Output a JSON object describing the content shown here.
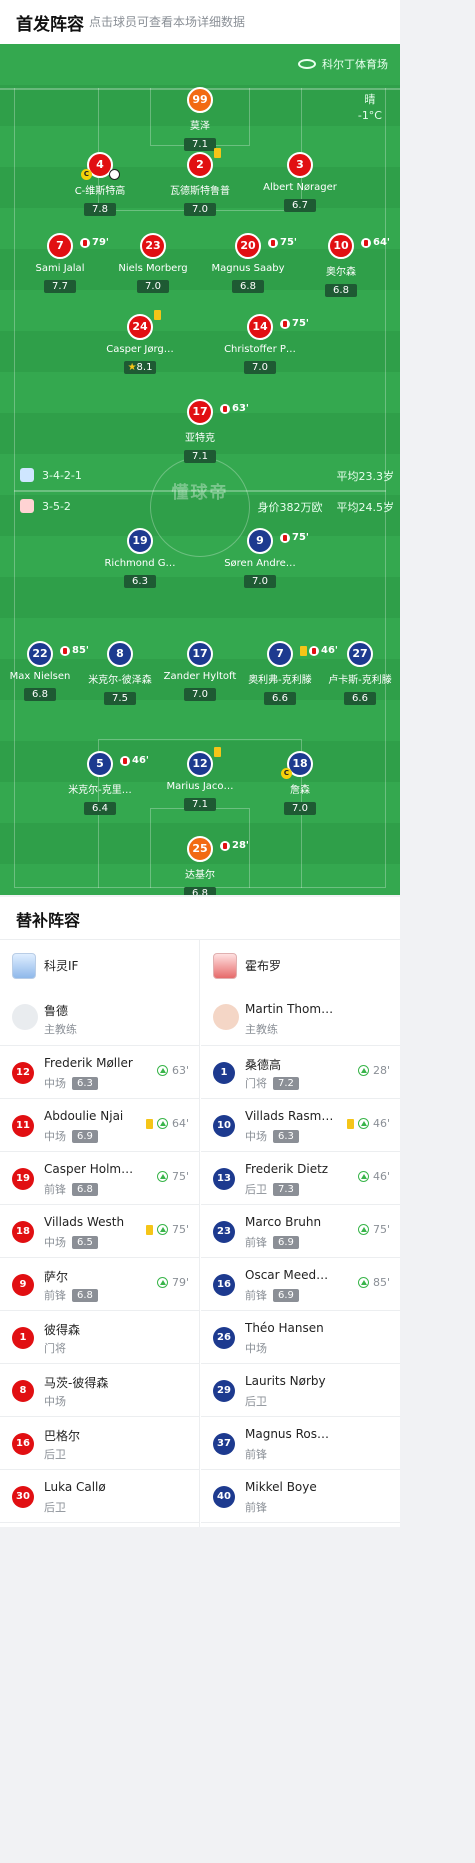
{
  "header": {
    "title": "首发阵容",
    "subtitle": "点击球员可查看本场详细数据"
  },
  "field": {
    "venue": "科尔丁体育场",
    "weather": {
      "condition": "晴",
      "temperature": "-1°C"
    },
    "watermark": "懂球帝",
    "home": {
      "formation": "3-4-2-1",
      "avg_age": "平均23.3岁"
    },
    "away": {
      "formation": "3-5-2",
      "value": "身价382万欧",
      "avg_age": "平均24.5岁"
    }
  },
  "home_players": [
    {
      "num": "99",
      "name": "莫泽",
      "rating": "7.1"
    },
    {
      "num": "4",
      "name": "C-维斯特高",
      "rating": "7.8"
    },
    {
      "num": "2",
      "name": "瓦德斯特鲁普",
      "rating": "7.0"
    },
    {
      "num": "3",
      "name": "Albert Nørager",
      "rating": "6.7"
    },
    {
      "num": "7",
      "name": "Sami Jalal",
      "rating": "7.7",
      "sub": "79'"
    },
    {
      "num": "23",
      "name": "Niels Morberg",
      "rating": "7.0"
    },
    {
      "num": "20",
      "name": "Magnus Saaby",
      "rating": "6.8",
      "sub": "75'"
    },
    {
      "num": "10",
      "name": "奥尔森",
      "rating": "6.8",
      "sub": "64'"
    },
    {
      "num": "24",
      "name": "Casper Jørg…",
      "rating": "8.1"
    },
    {
      "num": "14",
      "name": "Christoffer P…",
      "rating": "7.0",
      "sub": "75'"
    },
    {
      "num": "17",
      "name": "亚特克",
      "rating": "7.1",
      "sub": "63'"
    }
  ],
  "away_players": [
    {
      "num": "19",
      "name": "Richmond G…",
      "rating": "6.3"
    },
    {
      "num": "9",
      "name": "Søren Andre…",
      "rating": "7.0",
      "sub": "75'"
    },
    {
      "num": "22",
      "name": "Max Nielsen",
      "rating": "6.8",
      "sub": "85'"
    },
    {
      "num": "8",
      "name": "米克尔-彼泽森",
      "rating": "7.5"
    },
    {
      "num": "17",
      "name": "Zander Hyltoft",
      "rating": "7.0"
    },
    {
      "num": "7",
      "name": "奥利弗-克利滕",
      "rating": "6.6",
      "sub": "46'"
    },
    {
      "num": "27",
      "name": "卢卡斯-克利滕",
      "rating": "6.6"
    },
    {
      "num": "5",
      "name": "米克尔-克里…",
      "rating": "6.4",
      "sub": "46'"
    },
    {
      "num": "12",
      "name": "Marius Jaco…",
      "rating": "7.1"
    },
    {
      "num": "18",
      "name": "詹森",
      "rating": "7.0"
    },
    {
      "num": "25",
      "name": "达基尔",
      "rating": "6.8",
      "sub": "28'"
    }
  ],
  "subs": {
    "title": "替补阵容",
    "home_team": "科灵IF",
    "away_team": "霍布罗",
    "home_coach": {
      "name": "鲁德",
      "role": "主教练"
    },
    "away_coach": {
      "name": "Martin Thomsen",
      "role": "主教练"
    },
    "home": [
      {
        "num": "12",
        "name": "Frederik Møller",
        "pos": "中场",
        "rating": "6.3",
        "in": "63'"
      },
      {
        "num": "11",
        "name": "Abdoulie Njai",
        "pos": "中场",
        "rating": "6.9",
        "in": "64'"
      },
      {
        "num": "19",
        "name": "Casper Holm…",
        "pos": "前锋",
        "rating": "6.8",
        "in": "75'"
      },
      {
        "num": "18",
        "name": "Villads Westh",
        "pos": "中场",
        "rating": "6.5",
        "in": "75'"
      },
      {
        "num": "9",
        "name": "萨尔",
        "pos": "前锋",
        "rating": "6.8",
        "in": "79'"
      },
      {
        "num": "1",
        "name": "彼得森",
        "pos": "门将"
      },
      {
        "num": "8",
        "name": "马茨-彼得森",
        "pos": "中场"
      },
      {
        "num": "16",
        "name": "巴格尔",
        "pos": "后卫"
      },
      {
        "num": "30",
        "name": "Luka Callø",
        "pos": "后卫"
      }
    ],
    "away": [
      {
        "num": "1",
        "name": "桑德高",
        "pos": "门将",
        "rating": "7.2",
        "in": "28'"
      },
      {
        "num": "10",
        "name": "Villads Rasm…",
        "pos": "中场",
        "rating": "6.3",
        "in": "46'"
      },
      {
        "num": "13",
        "name": "Frederik Dietz",
        "pos": "后卫",
        "rating": "7.3",
        "in": "46'"
      },
      {
        "num": "23",
        "name": "Marco Bruhn",
        "pos": "前锋",
        "rating": "6.9",
        "in": "75'"
      },
      {
        "num": "16",
        "name": "Oscar Meedom",
        "pos": "前锋",
        "rating": "6.9",
        "in": "85'"
      },
      {
        "num": "26",
        "name": "Théo Hansen",
        "pos": "中场"
      },
      {
        "num": "29",
        "name": "Laurits Nørby",
        "pos": "后卫"
      },
      {
        "num": "37",
        "name": "Magnus Ros…",
        "pos": "前锋"
      },
      {
        "num": "40",
        "name": "Mikkel Boye",
        "pos": "前锋"
      }
    ]
  }
}
